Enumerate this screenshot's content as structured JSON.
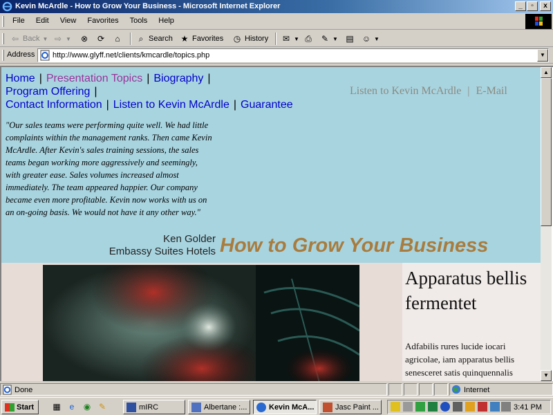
{
  "window": {
    "title": "Kevin McArdle - How to Grow Your Business - Microsoft Internet Explorer",
    "min_label": "_",
    "max_label": "▫",
    "close_label": "x"
  },
  "menu": [
    "File",
    "Edit",
    "View",
    "Favorites",
    "Tools",
    "Help"
  ],
  "toolbar": {
    "back": "Back",
    "search": "Search",
    "favorites": "Favorites",
    "history": "History"
  },
  "address": {
    "label": "Address",
    "url": "http://www.glyff.net/clients/kmcardle/topics.php"
  },
  "page": {
    "nav": [
      {
        "label": "Home",
        "current": false
      },
      {
        "label": "Presentation Topics",
        "current": true
      },
      {
        "label": "Biography",
        "current": false
      },
      {
        "label": "Program Offering",
        "current": false
      },
      {
        "label": "Contact Information",
        "current": false
      },
      {
        "label": "Listen to Kevin McArdle",
        "current": false
      },
      {
        "label": "Guarantee",
        "current": false
      }
    ],
    "top_links": [
      "Listen to Kevin McArdle",
      "E-Mail"
    ],
    "quote": "\"Our sales teams were performing quite well. We had little complaints within the management ranks. Then came Kevin McArdle. After Kevin's sales training sessions, the sales teams began working more aggressively and seemingly, with greater ease. Sales volumes increased almost immediately. The team appeared happier. Our company became even more profitable. Kevin now works with us on an on-going basis. We would not have it any other way.\"",
    "attribution_name": "Ken Golder",
    "attribution_company": "Embassy Suites Hotels",
    "headline": "How to Grow Your Business",
    "side_title": "Apparatus bellis fermentet",
    "side_body": "Adfabilis rures lucide iocari agricolae, iam apparatus bellis senesceret satis quinquennalis"
  },
  "status": {
    "text": "Done",
    "zone": "Internet"
  },
  "taskbar": {
    "start": "Start",
    "tasks": [
      {
        "label": "mIRC",
        "active": false
      },
      {
        "label": "Albertane :...",
        "active": false
      },
      {
        "label": "Kevin McA...",
        "active": true
      },
      {
        "label": "Jasc Paint ...",
        "active": false
      }
    ],
    "clock": "3:41 PM"
  },
  "colors": {
    "header_band": "#a8d4e0",
    "headline": "#a87c3e",
    "link": "#0000cc",
    "current_link": "#993399"
  }
}
